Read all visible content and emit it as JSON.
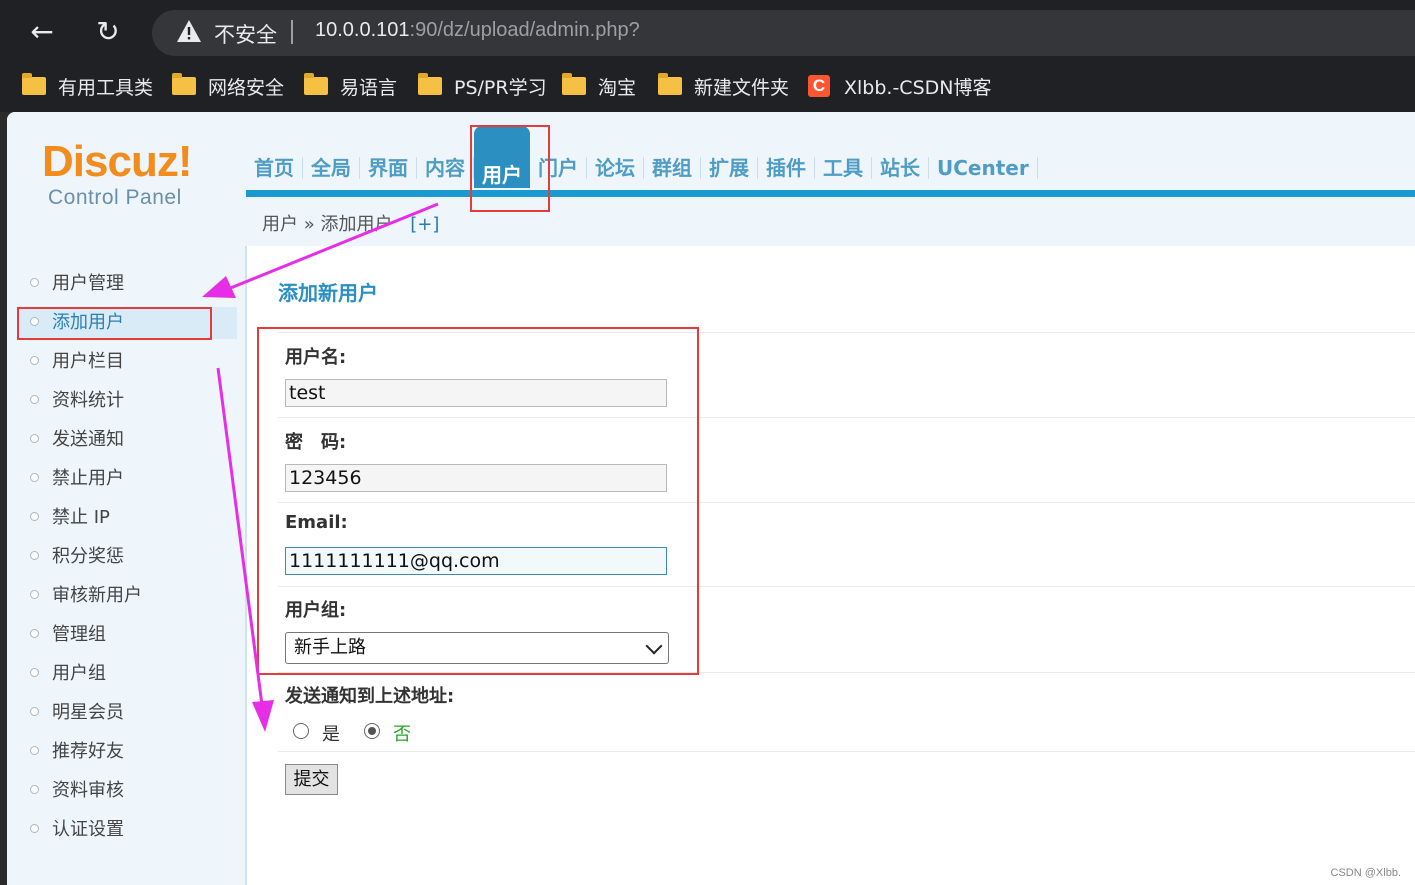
{
  "browser": {
    "insecure_label": "不安全",
    "url_host": "10.0.0.101",
    "url_path": ":90/dz/upload/admin.php?",
    "bookmarks": [
      "有用工具类",
      "网络安全",
      "易语言",
      "PS/PR学习",
      "淘宝",
      "新建文件夹"
    ],
    "csdn_bookmark": "Xlbb.-CSDN博客",
    "csdn_icon_letter": "C"
  },
  "logo": {
    "title": "Discuz!",
    "subtitle": "Control Panel"
  },
  "topnav": [
    "首页",
    "全局",
    "界面",
    "内容",
    "用户",
    "门户",
    "论坛",
    "群组",
    "扩展",
    "插件",
    "工具",
    "站长",
    "UCenter"
  ],
  "breadcrumb": {
    "section": "用户",
    "separator": "»",
    "page": "添加用户",
    "plus": "[+]"
  },
  "sidebar": [
    "用户管理",
    "添加用户",
    "用户栏目",
    "资料统计",
    "发送通知",
    "禁止用户",
    "禁止 IP",
    "积分奖惩",
    "审核新用户",
    "管理组",
    "用户组",
    "明星会员",
    "推荐好友",
    "资料审核",
    "认证设置"
  ],
  "form": {
    "title": "添加新用户",
    "username_label": "用户名:",
    "username_value": "test",
    "password_label": "密　码:",
    "password_value": "123456",
    "email_label": "Email:",
    "email_value": "1111111111@qq.com",
    "group_label": "用户组:",
    "group_value": "新手上路",
    "notify_label": "发送通知到上述地址:",
    "notify_yes": "是",
    "notify_no": "否",
    "submit_label": "提交"
  },
  "watermark": "CSDN @Xlbb.",
  "colors": {
    "accent": "#1b9ad2",
    "annotation_red": "#e53b3b",
    "annotation_magenta": "#e62ee6",
    "logo_orange": "#f28c1d"
  }
}
